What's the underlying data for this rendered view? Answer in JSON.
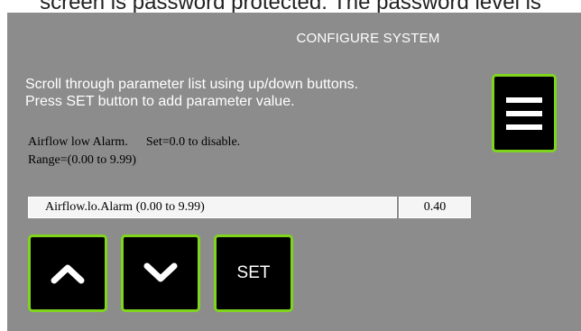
{
  "top_caption": "screen is password protected. The password level is",
  "title": "CONFIGURE SYSTEM",
  "instructions": {
    "line1": "Scroll through parameter list using up/down buttons.",
    "line2": "Press SET button to add parameter value."
  },
  "parameter_description": {
    "name": "Airflow low Alarm.",
    "note": "Set=0.0 to disable.",
    "range": "Range=(0.00 to 9.99)"
  },
  "parameter_field": {
    "label": "Airflow.lo.Alarm   (0.00 to 9.99)",
    "value": "0.40"
  },
  "buttons": {
    "menu_icon": "hamburger-menu-icon",
    "up_icon": "chevron-up-icon",
    "down_icon": "chevron-down-icon",
    "set_label": "SET"
  },
  "colors": {
    "panel_bg": "#8c8c8c",
    "button_bg": "#000000",
    "button_border": "#7fd51c",
    "field_bg": "#f5f5f5"
  }
}
